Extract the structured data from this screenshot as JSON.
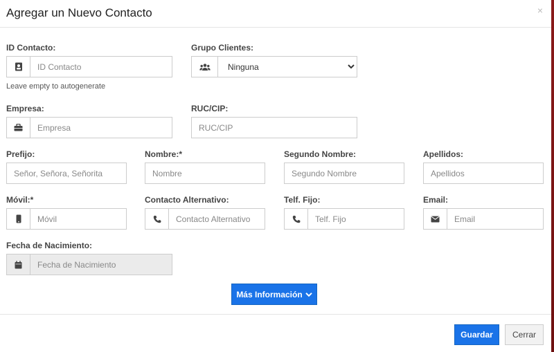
{
  "modal": {
    "title": "Agregar un Nuevo Contacto",
    "close_label": "×"
  },
  "fields": {
    "id_contacto": {
      "label": "ID Contacto:",
      "placeholder": "ID Contacto",
      "help": "Leave empty to autogenerate",
      "icon": "contact-card-icon"
    },
    "grupo_clientes": {
      "label": "Grupo Clientes:",
      "selected": "Ninguna",
      "icon": "users-icon"
    },
    "empresa": {
      "label": "Empresa:",
      "placeholder": "Empresa",
      "icon": "briefcase-icon"
    },
    "ruc_cip": {
      "label": "RUC/CIP:",
      "placeholder": "RUC/CIP"
    },
    "prefijo": {
      "label": "Prefijo:",
      "placeholder": "Señor, Señora, Señorita"
    },
    "nombre": {
      "label": "Nombre:*",
      "placeholder": "Nombre"
    },
    "segundo_nombre": {
      "label": "Segundo Nombre:",
      "placeholder": "Segundo Nombre"
    },
    "apellidos": {
      "label": "Apellidos:",
      "placeholder": "Apellidos"
    },
    "movil": {
      "label": "Móvil:*",
      "placeholder": "Móvil",
      "icon": "mobile-phone-icon"
    },
    "contacto_alternativo": {
      "label": "Contacto Alternativo:",
      "placeholder": "Contacto Alternativo",
      "icon": "phone-icon"
    },
    "telf_fijo": {
      "label": "Telf. Fijo:",
      "placeholder": "Telf. Fijo",
      "icon": "phone-icon"
    },
    "email": {
      "label": "Email:",
      "placeholder": "Email",
      "icon": "envelope-icon"
    },
    "fecha_nacimiento": {
      "label": "Fecha de Nacimiento:",
      "placeholder": "Fecha de Nacimiento",
      "icon": "calendar-icon"
    }
  },
  "buttons": {
    "more_info": "Más Información",
    "save": "Guardar",
    "close": "Cerrar"
  },
  "colors": {
    "primary": "#1a73e8",
    "backdrop": "#8a1a1a"
  }
}
